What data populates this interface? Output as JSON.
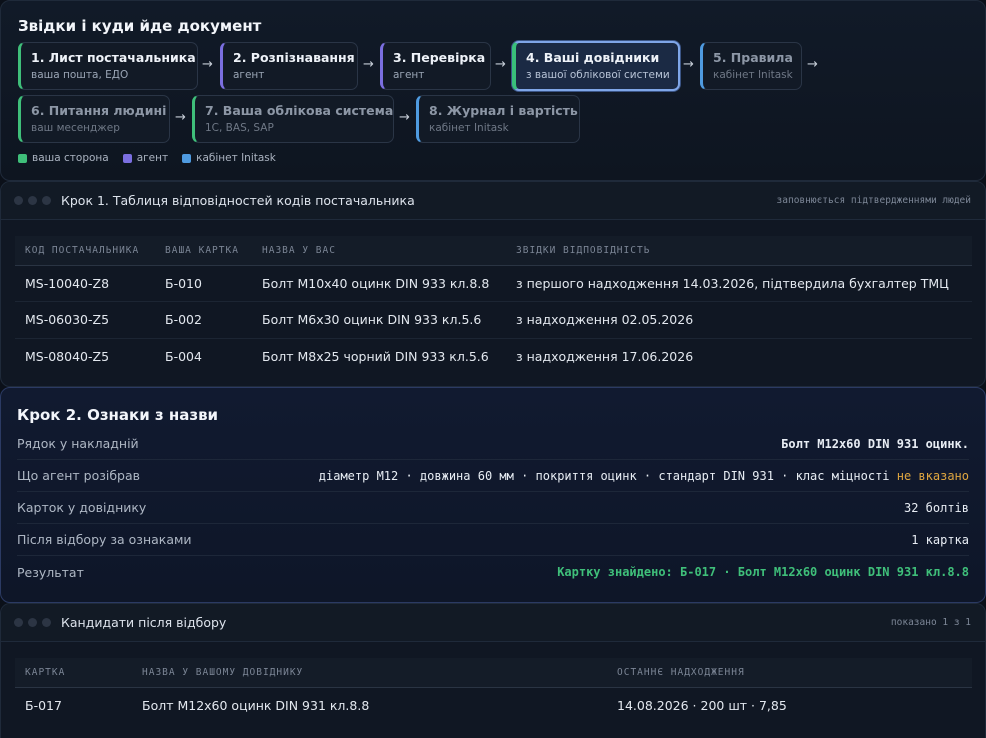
{
  "flow": {
    "title": "Звідки і куди йде документ",
    "steps": [
      {
        "title": "1. Лист постачальника",
        "sub": "ваша пошта, ЕДО"
      },
      {
        "title": "2. Розпізнавання",
        "sub": "агент"
      },
      {
        "title": "3. Перевірка",
        "sub": "агент"
      },
      {
        "title": "4. Ваші довідники",
        "sub": "з вашої облікової системи"
      },
      {
        "title": "5. Правила",
        "sub": "кабінет Initask"
      },
      {
        "title": "6. Питання людині",
        "sub": "ваш месенджер"
      },
      {
        "title": "7. Ваша облікова система",
        "sub": "1С, BAS, SAP"
      },
      {
        "title": "8. Журнал і вартість",
        "sub": "кабінет Initask"
      }
    ],
    "arrow": "→",
    "legend": [
      {
        "label": "ваша сторона",
        "color": "#3fbf7a"
      },
      {
        "label": "агент",
        "color": "#7b6fe0"
      },
      {
        "label": "кабінет Initask",
        "color": "#4f9be0"
      }
    ]
  },
  "step1": {
    "title": "Крок 1. Таблиця відповідностей кодів постачальника",
    "meta": "заповнюється підтвердженнями людей",
    "columns": [
      "КОД ПОСТАЧАЛЬНИКА",
      "ВАША КАРТКА",
      "НАЗВА У ВАС",
      "ЗВІДКИ ВІДПОВІДНІСТЬ"
    ],
    "rows": [
      [
        "MS-10040-Z8",
        "Б-010",
        "Болт М10х40 оцинк DIN 933 кл.8.8",
        "з першого надходження 14.03.2026, підтвердила бухгалтер ТМЦ"
      ],
      [
        "MS-06030-Z5",
        "Б-002",
        "Болт М6х30 оцинк DIN 933 кл.5.6",
        "з надходження 02.05.2026"
      ],
      [
        "MS-08040-Z5",
        "Б-004",
        "Болт М8х25 чорний DIN 933 кл.5.6",
        "з надходження 17.06.2026"
      ]
    ]
  },
  "step2": {
    "title": "Крок 2. Ознаки з назви",
    "rows": {
      "invoice_line": {
        "label": "Рядок у накладній",
        "value": "Болт М12х60 DIN 931 оцинк."
      },
      "parsed": {
        "label": "Що агент розібрав",
        "value": "діаметр М12 · довжина 60 мм · покриття оцинк · стандарт DIN 931 · клас міцності ",
        "missing": "не вказано"
      },
      "cards_total": {
        "label": "Карток у довіднику",
        "value": "32 болтів"
      },
      "after_filter": {
        "label": "Після відбору за ознаками",
        "value": "1 картка"
      },
      "result": {
        "label": "Результат",
        "value": "Картку знайдено: Б-017 · Болт М12х60 оцинк DIN 931 кл.8.8"
      }
    }
  },
  "candidates": {
    "title": "Кандидати після відбору",
    "meta": "показано 1 з 1",
    "columns": [
      "КАРТКА",
      "НАЗВА У ВАШОМУ ДОВІДНИКУ",
      "ОСТАННЄ НАДХОДЖЕННЯ"
    ],
    "rows": [
      [
        "Б-017",
        "Болт М12х60 оцинк DIN 931 кл.8.8",
        "14.08.2026 · 200 шт · 7,85"
      ]
    ]
  }
}
